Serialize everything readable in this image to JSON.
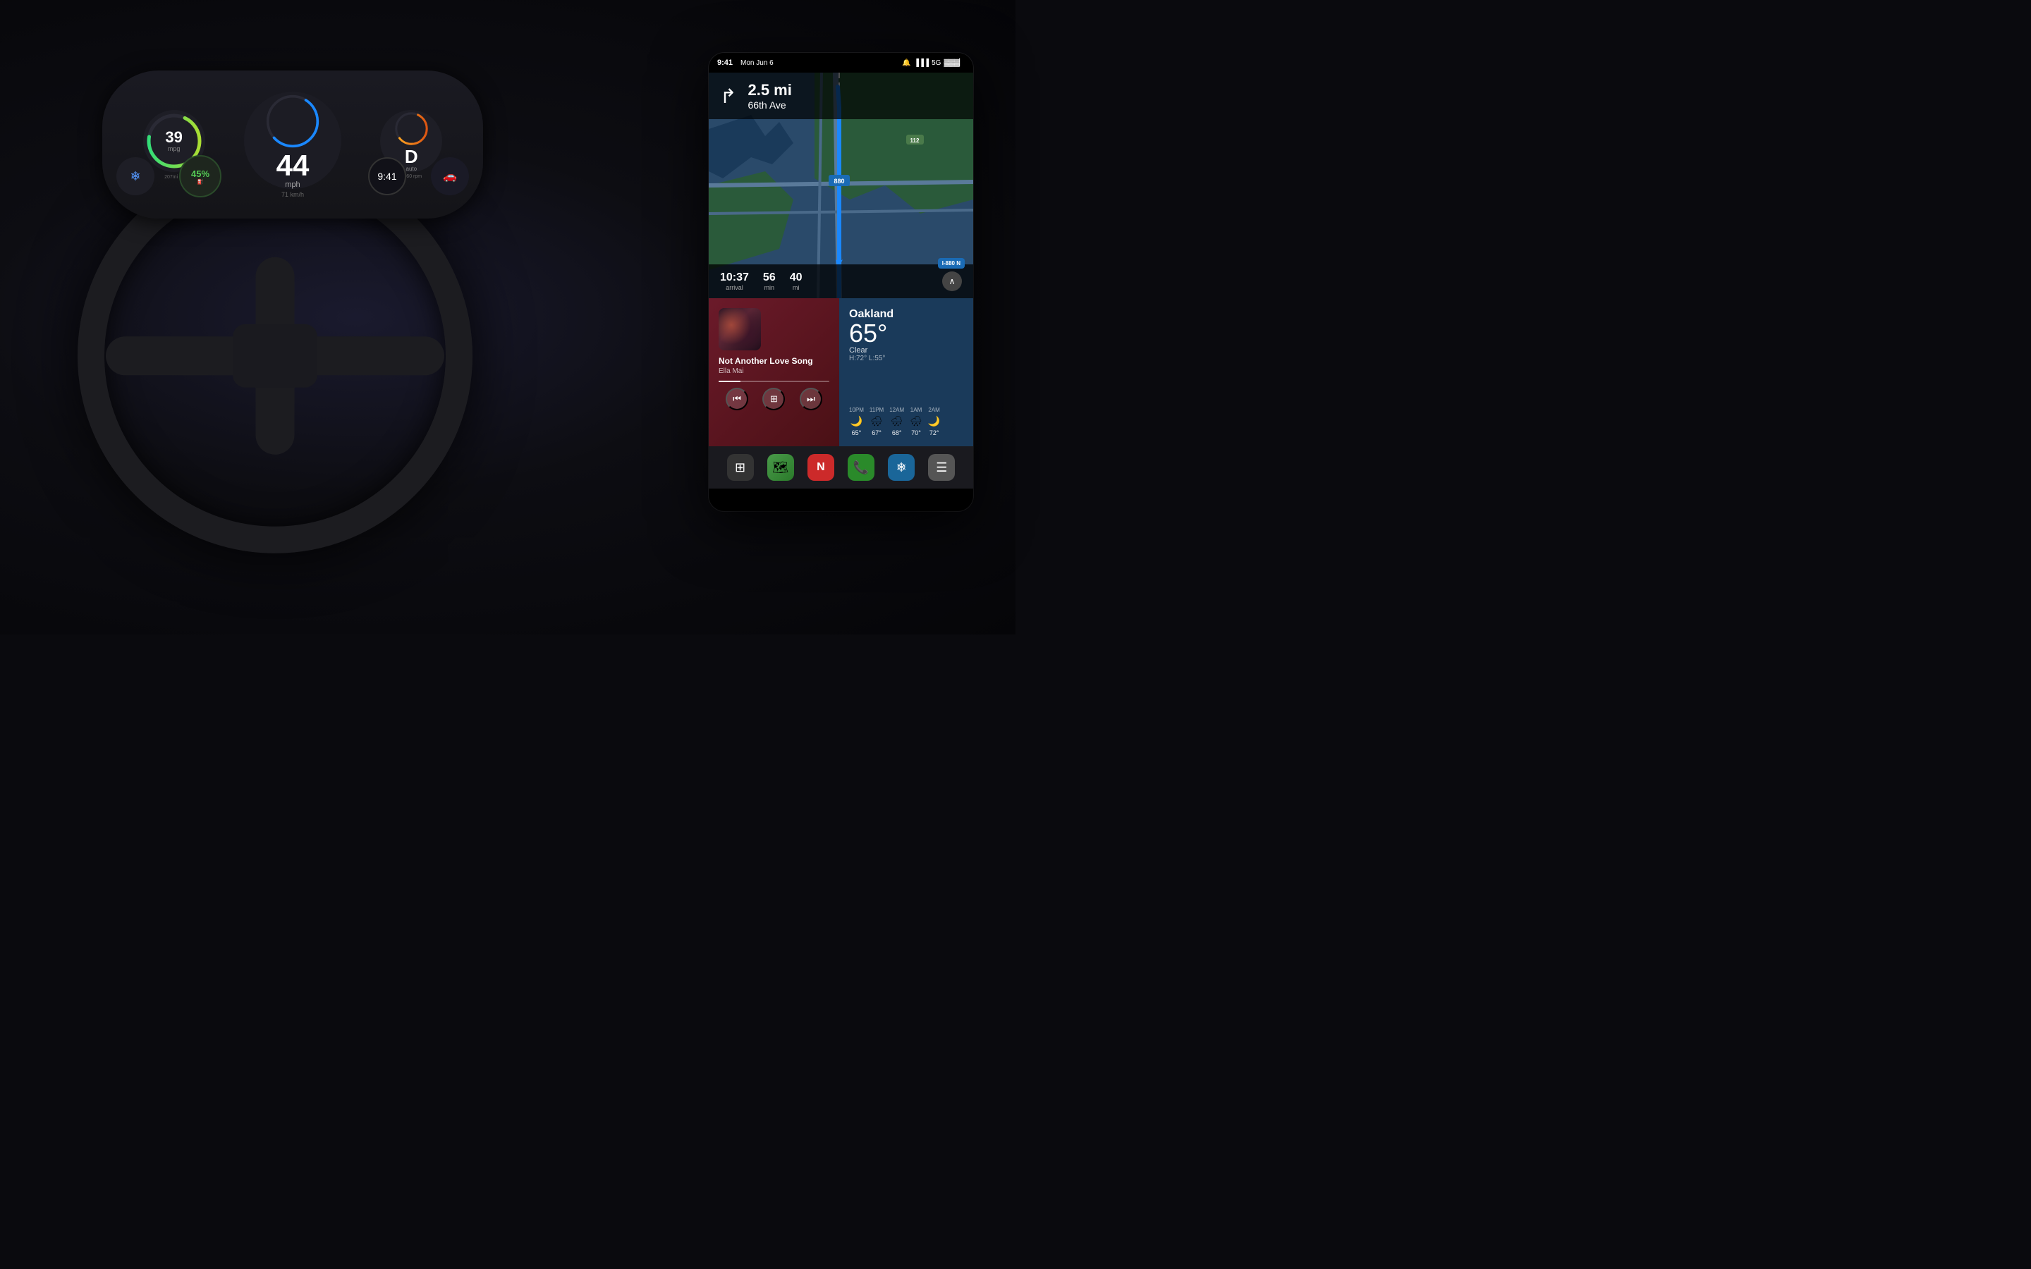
{
  "background": {
    "color": "#0a0a0e"
  },
  "dashboard": {
    "mpg_value": "39",
    "mpg_unit": "mpg",
    "mpg_sub": "207mi ⬡",
    "speed_value": "44",
    "speed_unit": "mph",
    "speed_kmh": "71 km/h",
    "gear_value": "D",
    "gear_label": "auto",
    "gear_rpm": "2560 rpm",
    "battery_percent": "45%",
    "battery_sub": "fuel",
    "time_display": "9:41"
  },
  "status_bar": {
    "time": "9:41",
    "date": "Mon Jun 6",
    "signal": "5G",
    "battery": "●●●"
  },
  "navigation": {
    "distance": "2.5 mi",
    "street": "66th Ave",
    "arrival": "10:37",
    "arrival_label": "arrival",
    "minutes": "56",
    "minutes_label": "min",
    "miles": "40",
    "miles_label": "mi",
    "route": "I-880 N",
    "highway1": "880",
    "highway2": "112"
  },
  "music": {
    "song_title": "Not Another Love Song",
    "artist": "Ella Mai",
    "progress_percent": 20,
    "prev_label": "⏮",
    "grid_label": "⊞",
    "next_label": "⏭"
  },
  "weather": {
    "city": "Oakland",
    "temperature": "65°",
    "condition": "Clear",
    "high": "H:72°",
    "low": "L:55°",
    "hourly": [
      {
        "time": "10PM",
        "icon": "🌙",
        "temp": "65°"
      },
      {
        "time": "11PM",
        "icon": "🌧",
        "temp": "67°"
      },
      {
        "time": "12AM",
        "icon": "🌧",
        "temp": "68°"
      },
      {
        "time": "1AM",
        "icon": "🌧",
        "temp": "70°"
      },
      {
        "time": "2AM",
        "icon": "🌙",
        "temp": "72°"
      }
    ]
  },
  "dock": {
    "items": [
      {
        "name": "grid",
        "icon": "⊞",
        "label": "Grid"
      },
      {
        "name": "maps",
        "icon": "🗺",
        "label": "Maps"
      },
      {
        "name": "news",
        "icon": "📰",
        "label": "News"
      },
      {
        "name": "phone",
        "icon": "📞",
        "label": "Phone"
      },
      {
        "name": "fan",
        "icon": "❄",
        "label": "Climate"
      },
      {
        "name": "cards",
        "icon": "☰",
        "label": "Cards"
      }
    ]
  }
}
